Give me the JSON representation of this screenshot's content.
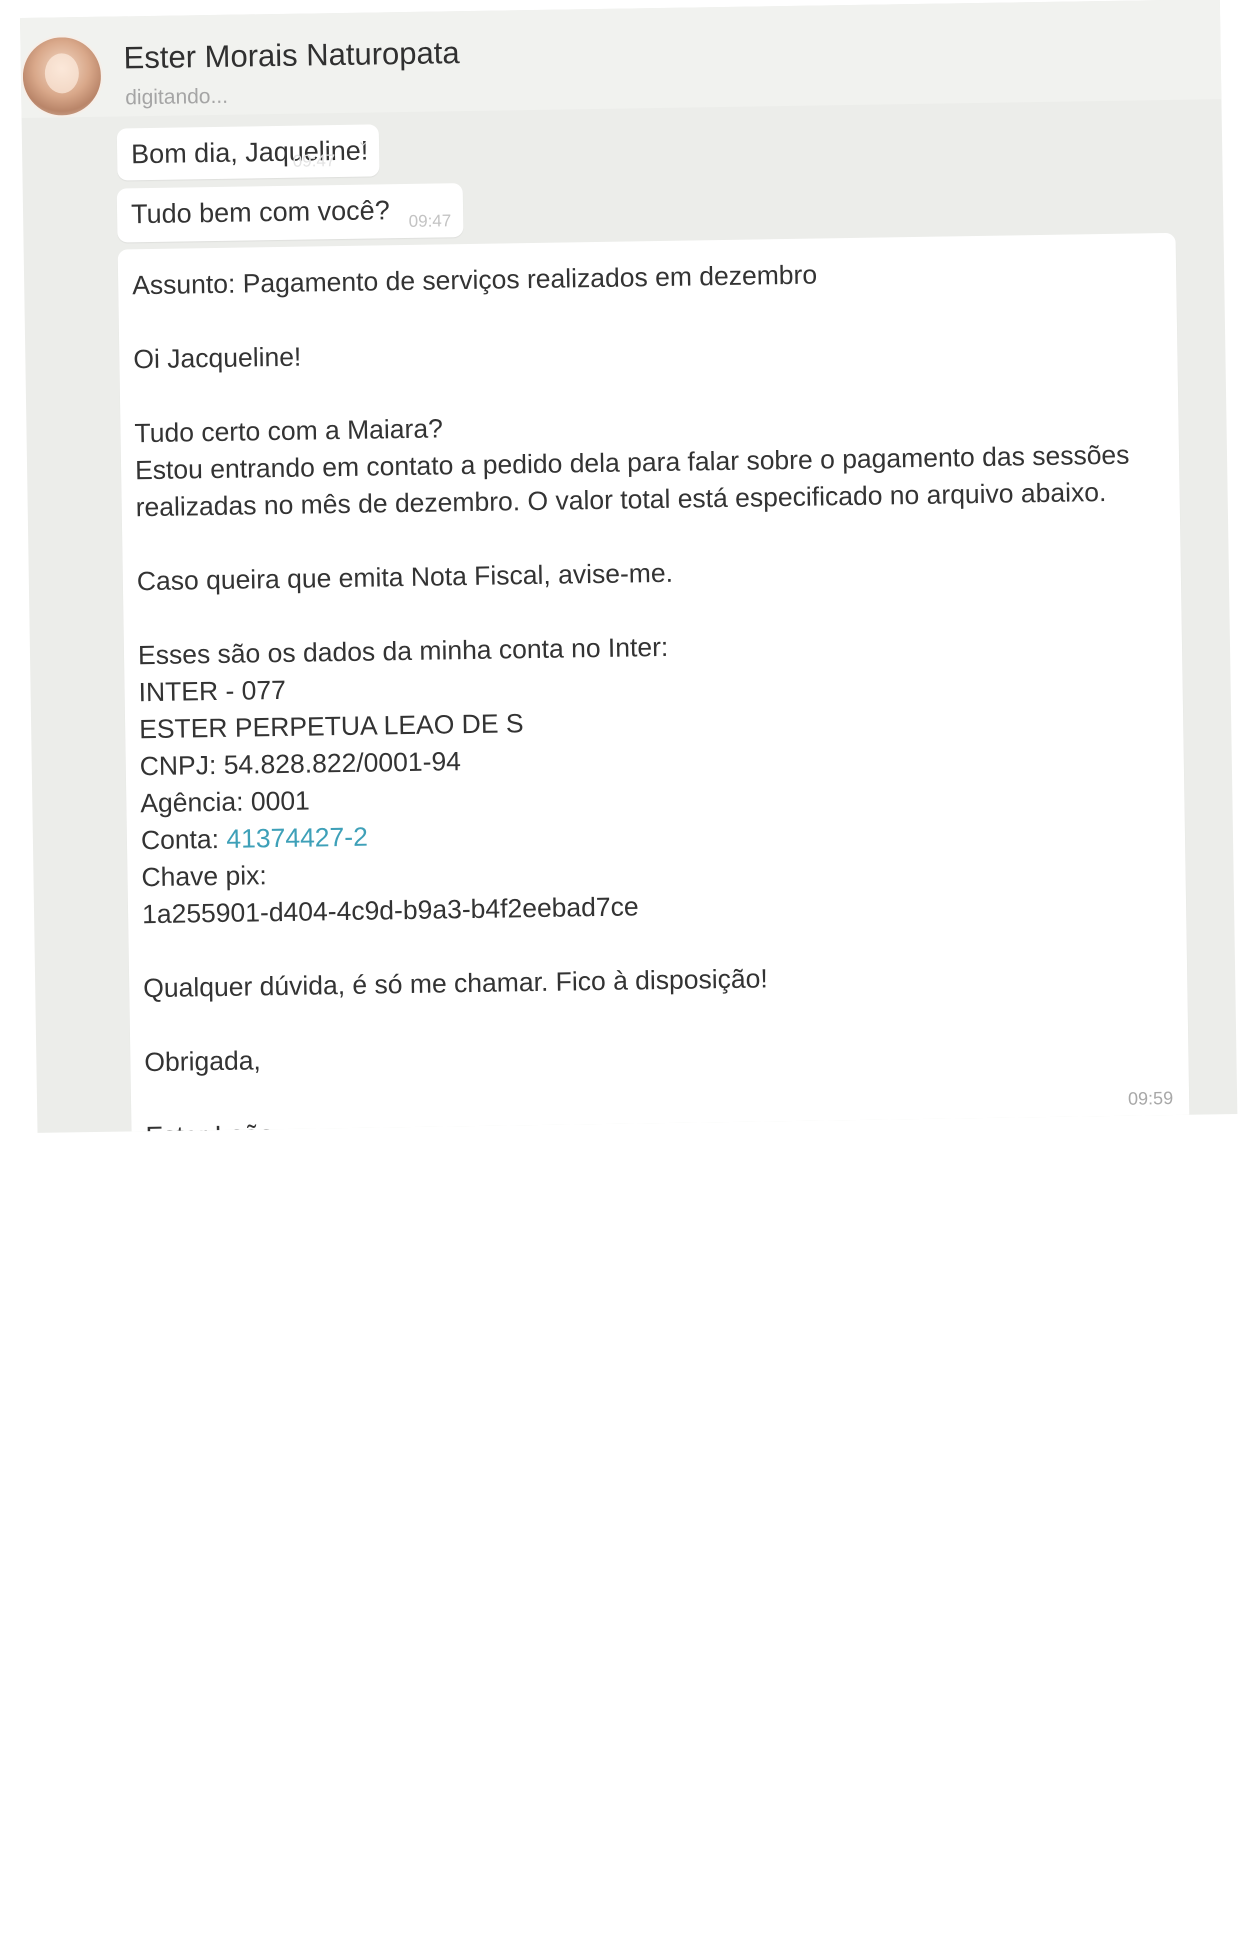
{
  "chat": {
    "contact_name": "Ester Morais Naturopata",
    "status": "digitando..."
  },
  "messages": [
    {
      "text": "Bom dia, Jaqueline!",
      "time": "09:47"
    },
    {
      "text": "Tudo bem com você?",
      "time": "09:47"
    },
    {
      "time": "09:59",
      "subject": "Assunto: Pagamento de serviços realizados em dezembro",
      "greeting": "Oi Jacqueline!",
      "p1_line1": "Tudo certo com a Maiara?",
      "p1_line2": "Estou entrando em contato a pedido dela para falar sobre o pagamento das sessões",
      "p1_line3": "realizadas no mês de dezembro. O valor total está especificado no arquivo abaixo.",
      "invoice": "Caso queira que emita Nota Fiscal, avise-me.",
      "bank_intro": "Esses são os dados da minha conta no Inter:",
      "bank": "INTER - 077",
      "holder": "ESTER PERPETUA LEAO DE S",
      "cnpj": "CNPJ: 54.828.822/0001-94",
      "agency": "Agência: 0001",
      "account_label": "Conta: ",
      "account_number": "41374427-2",
      "pix_label": "Chave pix:",
      "pix_key": "1a255901-d404-4c9d-b9a3-b4f2eebad7ce",
      "closing": "Qualquer dúvida, é só me chamar. Fico à disposição!",
      "thanks": "Obrigada,",
      "signature": "Ester Leão"
    }
  ]
}
